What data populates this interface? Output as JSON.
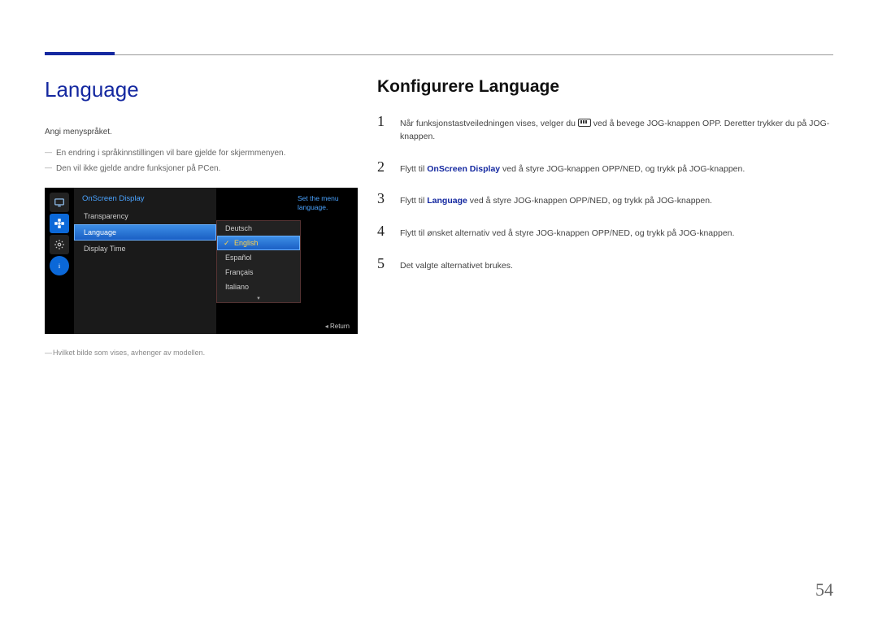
{
  "page_number": "54",
  "left": {
    "title": "Language",
    "intro": "Angi menyspråket.",
    "notes": [
      "En endring i språkinnstillingen vil bare gjelde for skjermmenyen.",
      "Den vil ikke gjelde andre funksjoner på PCen."
    ],
    "footnote": "Hvilket bilde som vises, avhenger av modellen."
  },
  "osd": {
    "header": "OnScreen Display",
    "items": [
      "Transparency",
      "Language",
      "Display Time"
    ],
    "selected_item_index": 1,
    "sub_items": [
      "Deutsch",
      "English",
      "Español",
      "Français",
      "Italiano"
    ],
    "sub_selected_index": 1,
    "help_text": "Set the menu language.",
    "return_label": "Return"
  },
  "right": {
    "title": "Konfigurere Language",
    "steps": [
      {
        "num": "1",
        "segs": [
          "Når funksjonstastveiledningen vises, velger du ",
          {
            "icon": true
          },
          " ved å bevege JOG-knappen OPP. Deretter trykker du på JOG-knappen."
        ]
      },
      {
        "num": "2",
        "segs": [
          "Flytt til ",
          {
            "bold": "OnScreen Display"
          },
          " ved å styre JOG-knappen OPP/NED, og trykk på JOG-knappen."
        ]
      },
      {
        "num": "3",
        "segs": [
          "Flytt til ",
          {
            "bold": "Language"
          },
          " ved å styre JOG-knappen OPP/NED, og trykk på JOG-knappen."
        ]
      },
      {
        "num": "4",
        "segs": [
          "Flytt til ønsket alternativ ved å styre JOG-knappen OPP/NED, og trykk på JOG-knappen."
        ]
      },
      {
        "num": "5",
        "segs": [
          "Det valgte alternativet brukes."
        ]
      }
    ]
  }
}
